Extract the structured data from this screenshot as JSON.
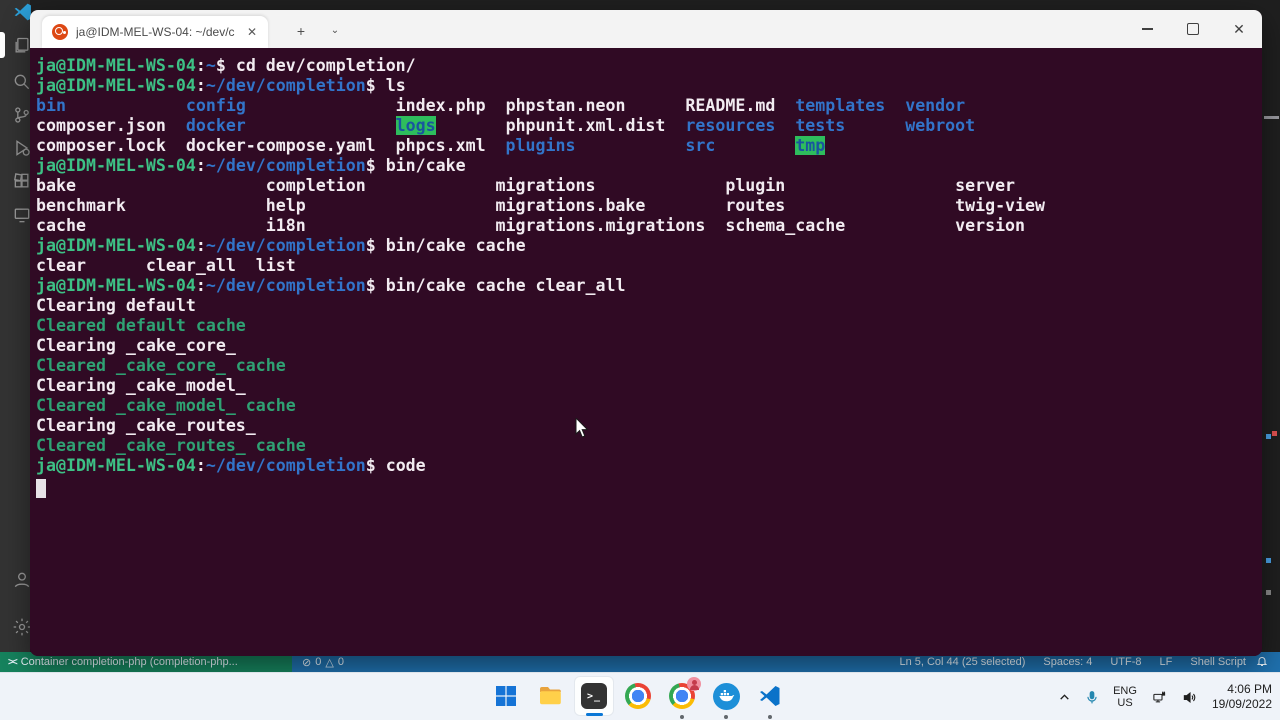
{
  "colors": {
    "terminal_bg": "#300a24",
    "prompt_green": "#3dc185",
    "cleared_green": "#2fa273",
    "dir_blue": "#3274c9",
    "highlight_bg": "#2ebd5d",
    "statusbar_blue": "#1f70ad",
    "remote_green": "#16825d",
    "taskbar_accent": "#0a77d6"
  },
  "window": {
    "tab_title": "ja@IDM-MEL-WS-04: ~/dev/c"
  },
  "terminal": {
    "lines": [
      [
        [
          "u",
          "ja@IDM-MEL-WS-04"
        ],
        [
          "w",
          ":"
        ],
        [
          "b",
          "~"
        ],
        [
          "w",
          "$ cd dev/completion/"
        ]
      ],
      [
        [
          "u",
          "ja@IDM-MEL-WS-04"
        ],
        [
          "w",
          ":"
        ],
        [
          "b",
          "~/dev/completion"
        ],
        [
          "w",
          "$ ls"
        ]
      ],
      [
        [
          "b",
          "bin"
        ],
        [
          "w",
          "            "
        ],
        [
          "b",
          "config"
        ],
        [
          "w",
          "               index.php  phpstan.neon      README.md  "
        ],
        [
          "b",
          "templates"
        ],
        [
          "w",
          "  "
        ],
        [
          "b",
          "vendor"
        ]
      ],
      [
        [
          "w",
          "composer.json  "
        ],
        [
          "b",
          "docker"
        ],
        [
          "w",
          "               "
        ],
        [
          "hl",
          "logs"
        ],
        [
          "w",
          "       phpunit.xml.dist  "
        ],
        [
          "b",
          "resources"
        ],
        [
          "w",
          "  "
        ],
        [
          "b",
          "tests"
        ],
        [
          "w",
          "      "
        ],
        [
          "b",
          "webroot"
        ]
      ],
      [
        [
          "w",
          "composer.lock  docker-compose.yaml  phpcs.xml  "
        ],
        [
          "b",
          "plugins"
        ],
        [
          "w",
          "           "
        ],
        [
          "b",
          "src"
        ],
        [
          "w",
          "        "
        ],
        [
          "hl",
          "tmp"
        ]
      ],
      [
        [
          "u",
          "ja@IDM-MEL-WS-04"
        ],
        [
          "w",
          ":"
        ],
        [
          "b",
          "~/dev/completion"
        ],
        [
          "w",
          "$ bin/cake"
        ]
      ],
      [
        [
          "w",
          "bake                   completion             migrations             plugin                 server"
        ]
      ],
      [
        [
          "w",
          "benchmark              help                   migrations.bake        routes                 twig-view"
        ]
      ],
      [
        [
          "w",
          "cache                  i18n                   migrations.migrations  schema_cache           version"
        ]
      ],
      [
        [
          "u",
          "ja@IDM-MEL-WS-04"
        ],
        [
          "w",
          ":"
        ],
        [
          "b",
          "~/dev/completion"
        ],
        [
          "w",
          "$ bin/cake cache"
        ]
      ],
      [
        [
          "w",
          "clear      clear_all  list"
        ]
      ],
      [
        [
          "u",
          "ja@IDM-MEL-WS-04"
        ],
        [
          "w",
          ":"
        ],
        [
          "b",
          "~/dev/completion"
        ],
        [
          "w",
          "$ bin/cake cache clear_all"
        ]
      ],
      [
        [
          "w",
          "Clearing default"
        ]
      ],
      [
        [
          "g",
          "Cleared default cache"
        ]
      ],
      [
        [
          "w",
          "Clearing _cake_core_"
        ]
      ],
      [
        [
          "g",
          "Cleared _cake_core_ cache"
        ]
      ],
      [
        [
          "w",
          "Clearing _cake_model_"
        ]
      ],
      [
        [
          "g",
          "Cleared _cake_model_ cache"
        ]
      ],
      [
        [
          "w",
          "Clearing _cake_routes_"
        ]
      ],
      [
        [
          "g",
          "Cleared _cake_routes_ cache"
        ]
      ],
      [
        [
          "u",
          "ja@IDM-MEL-WS-04"
        ],
        [
          "w",
          ":"
        ],
        [
          "b",
          "~/dev/completion"
        ],
        [
          "w",
          "$ code"
        ]
      ],
      [
        [
          "cur",
          " "
        ]
      ]
    ]
  },
  "vscode": {
    "statusbar": {
      "remote_label": "Container completion-php (completion-php...",
      "errors": "0",
      "warnings": "0",
      "right_items": [
        "Ln 5, Col 44 (25 selected)",
        "Spaces: 4",
        "UTF-8",
        "LF",
        "Shell Script"
      ]
    }
  },
  "taskbar": {
    "language_top": "ENG",
    "language_bottom": "US",
    "time": "4:06 PM",
    "date": "19/09/2022"
  }
}
